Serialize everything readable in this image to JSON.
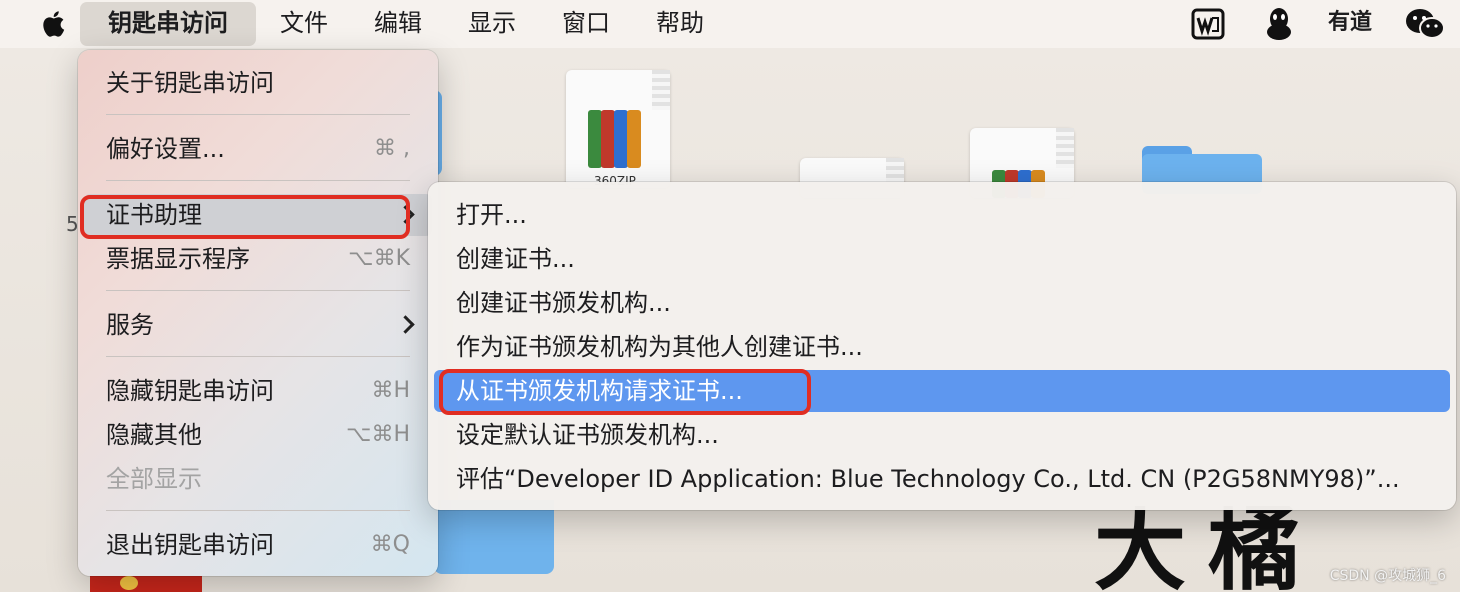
{
  "menubar": {
    "app_menu": "钥匙串访问",
    "items": [
      "文件",
      "编辑",
      "显示",
      "窗口",
      "帮助"
    ],
    "tray": {
      "youdao_label": "有道"
    }
  },
  "app_menu": {
    "about": "关于钥匙串访问",
    "preferences": {
      "label": "偏好设置...",
      "shortcut": "⌘ ,"
    },
    "cert_assistant": "证书助理",
    "ticket_viewer": {
      "label": "票据显示程序",
      "shortcut": "⌥⌘K"
    },
    "services": "服务",
    "hide": {
      "label": "隐藏钥匙串访问",
      "shortcut": "⌘H"
    },
    "hide_others": {
      "label": "隐藏其他",
      "shortcut": "⌥⌘H"
    },
    "show_all": "全部显示",
    "quit": {
      "label": "退出钥匙串访问",
      "shortcut": "⌘Q"
    }
  },
  "cert_submenu": {
    "items": [
      "打开...",
      "创建证书...",
      "创建证书颁发机构...",
      "作为证书颁发机构为其他人创建证书...",
      "从证书颁发机构请求证书...",
      "设定默认证书颁发机构...",
      "评估“Developer ID Application: Blue Technology Co., Ltd. CN (P2G58NMY98)”..."
    ],
    "highlighted_index": 4
  },
  "desktop": {
    "file_label": "360ZIP",
    "stray_digit": "5",
    "calligraphy": "大橘",
    "watermark": "CSDN @攻城狮_6"
  },
  "colors": {
    "highlight_blue": "#5e97ef",
    "annotation_red": "#e02d22"
  }
}
